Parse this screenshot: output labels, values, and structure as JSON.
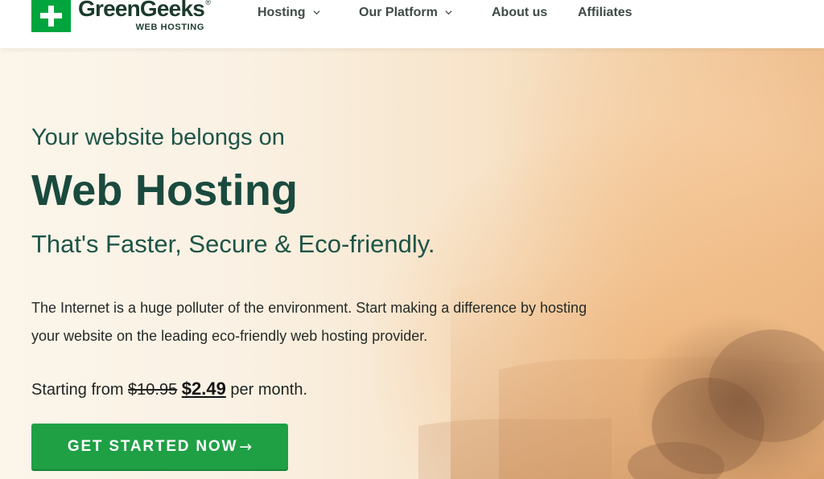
{
  "brand": {
    "name": "GreenGeeks",
    "registered_mark": "®",
    "tagline": "WEB HOSTING",
    "logo_icon": "plus-icon",
    "brand_color": "#00a53d"
  },
  "nav": {
    "items": [
      {
        "label": "Hosting",
        "has_dropdown": true
      },
      {
        "label": "Our Platform",
        "has_dropdown": true
      },
      {
        "label": "About us",
        "has_dropdown": false
      },
      {
        "label": "Affiliates",
        "has_dropdown": false
      }
    ]
  },
  "hero": {
    "pre_title": "Your website belongs on",
    "title": "Web Hosting",
    "subtitle": "That's Faster, Secure & Eco-friendly.",
    "description": "The Internet is a huge polluter of the environment. Start making a difference by hosting your website on the leading eco-friendly web hosting provider.",
    "price": {
      "prefix": "Starting from",
      "old_price": "$10.95",
      "new_price": "$2.49",
      "suffix": "per month."
    },
    "cta": {
      "label": "GET STARTED NOW",
      "arrow": "→",
      "color": "#1fa045"
    },
    "title_color": "#1a4a3e"
  }
}
